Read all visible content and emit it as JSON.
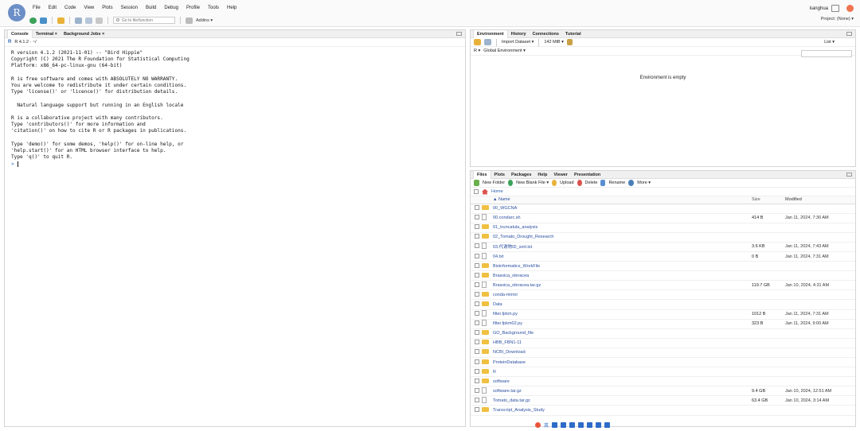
{
  "menu": [
    "File",
    "Edit",
    "Code",
    "View",
    "Plots",
    "Session",
    "Build",
    "Debug",
    "Profile",
    "Tools",
    "Help"
  ],
  "logo_letter": "R",
  "toolbar": {
    "goto_placeholder": "Go to file/function",
    "addins_label": "Addins ▾"
  },
  "user": "kanghua",
  "project": "Project: (None) ▾",
  "console": {
    "tabs": [
      {
        "label": "Console"
      },
      {
        "label": "Terminal ×"
      },
      {
        "label": "Background Jobs ×"
      }
    ],
    "path": "R 4.1.2 · ~/",
    "text": "R version 4.1.2 (2021-11-01) -- \"Bird Hippie\"\nCopyright (C) 2021 The R Foundation for Statistical Computing\nPlatform: x86_64-pc-linux-gnu (64-bit)\n\nR is free software and comes with ABSOLUTELY NO WARRANTY.\nYou are welcome to redistribute it under certain conditions.\nType 'license()' or 'licence()' for distribution details.\n\n  Natural language support but running in an English locale\n\nR is a collaborative project with many contributors.\nType 'contributors()' for more information and\n'citation()' on how to cite R or R packages in publications.\n\nType 'demo()' for some demos, 'help()' for on-line help, or\n'help.start()' for an HTML browser interface to help.\nType 'q()' to quit R.\n",
    "prompt": ">"
  },
  "env": {
    "tabs": [
      "Environment",
      "History",
      "Connections",
      "Tutorial"
    ],
    "import_label": "Import Dataset ▾",
    "memory": "142 MiB ▾",
    "list_label": "List ▾",
    "lang": "R ▾",
    "scope": "Global Environment ▾",
    "empty_msg": "Environment is empty"
  },
  "files": {
    "tabs": [
      "Files",
      "Plots",
      "Packages",
      "Help",
      "Viewer",
      "Presentation"
    ],
    "actions": [
      "New Folder",
      "New Blank File ▾",
      "Upload",
      "Delete",
      "Rename",
      "More ▾"
    ],
    "crumb": "Home",
    "headers": {
      "name": "▲ Name",
      "size": "Size",
      "modified": "Modified"
    },
    "rows": [
      {
        "type": "folder",
        "name": "00_WGCNA",
        "size": "",
        "modified": ""
      },
      {
        "type": "file",
        "name": "00.condarc.sh",
        "size": "414 B",
        "modified": "Jan 11, 2024, 7:30 AM"
      },
      {
        "type": "folder",
        "name": "01_truncatula_analysis",
        "size": "",
        "modified": ""
      },
      {
        "type": "folder",
        "name": "02_Tomato_Drought_Research",
        "size": "",
        "modified": ""
      },
      {
        "type": "file",
        "name": "03.代谢物ID_sort.txt",
        "size": "3.6 KB",
        "modified": "Jan 11, 2024, 7:43 AM"
      },
      {
        "type": "file",
        "name": "04.txt",
        "size": "0 B",
        "modified": "Jan 11, 2024, 7:31 AM"
      },
      {
        "type": "folder",
        "name": "Bioinformatics_WorkFile",
        "size": "",
        "modified": ""
      },
      {
        "type": "folder",
        "name": "Brassica_oleracea",
        "size": "",
        "modified": ""
      },
      {
        "type": "file",
        "name": "Brassica_oleracea.tar.gz",
        "size": "119.7 GB",
        "modified": "Jan 10, 2024, 4:31 AM"
      },
      {
        "type": "folder",
        "name": "conda-mirror",
        "size": "",
        "modified": ""
      },
      {
        "type": "folder",
        "name": "Data",
        "size": "",
        "modified": ""
      },
      {
        "type": "file",
        "name": "filter.fpkm.py",
        "size": "1012 B",
        "modified": "Jan 11, 2024, 7:31 AM"
      },
      {
        "type": "file",
        "name": "filter.fpkm02.py",
        "size": "323 B",
        "modified": "Jan 11, 2024, 9:00 AM"
      },
      {
        "type": "folder",
        "name": "GO_Background_file",
        "size": "",
        "modified": ""
      },
      {
        "type": "folder",
        "name": "HBB_FBN1-11",
        "size": "",
        "modified": ""
      },
      {
        "type": "folder",
        "name": "NCBI_Download",
        "size": "",
        "modified": ""
      },
      {
        "type": "folder",
        "name": "ProteinDatabase",
        "size": "",
        "modified": ""
      },
      {
        "type": "folder",
        "name": "R",
        "size": "",
        "modified": ""
      },
      {
        "type": "folder",
        "name": "software",
        "size": "",
        "modified": ""
      },
      {
        "type": "file",
        "name": "software.tar.gz",
        "size": "9.4 GB",
        "modified": "Jan 10, 2024, 12:51 AM"
      },
      {
        "type": "file",
        "name": "Tomato_data.tar.gz",
        "size": "63.4 GB",
        "modified": "Jan 10, 2024, 3:14 AM"
      },
      {
        "type": "folder",
        "name": "Transcript_Analysis_Study",
        "size": "",
        "modified": ""
      }
    ]
  },
  "taskbar_ime": "英"
}
